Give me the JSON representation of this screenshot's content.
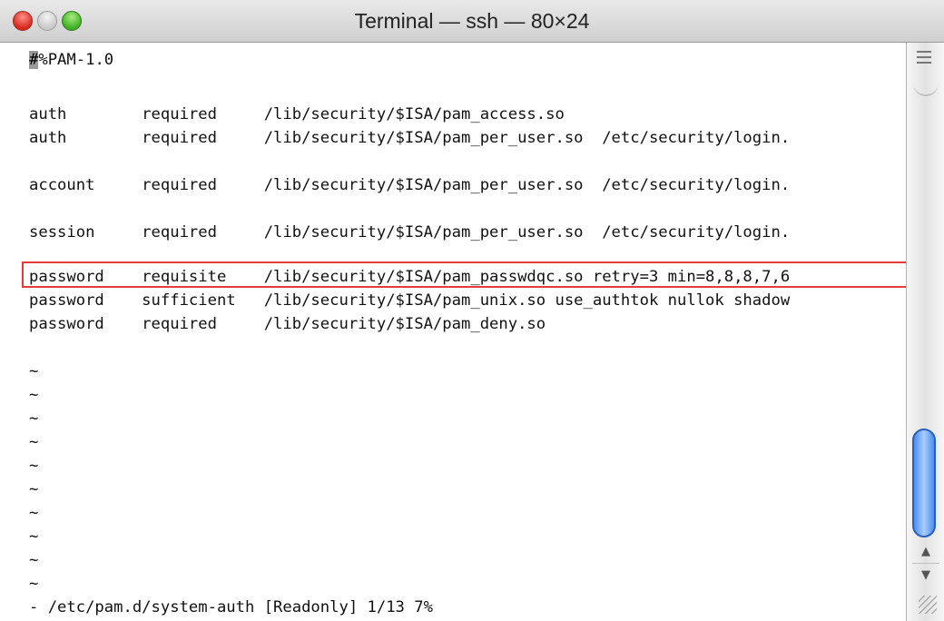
{
  "window": {
    "title": "Terminal — ssh — 80×24",
    "traffic_lights": [
      "close",
      "minimize",
      "zoom"
    ]
  },
  "terminal": {
    "lines": [
      "",
      "",
      "auth        required     /lib/security/$ISA/pam_access.so",
      "auth        required     /lib/security/$ISA/pam_per_user.so  /etc/security/login.",
      "",
      "account     required     /lib/security/$ISA/pam_per_user.so  /etc/security/login.",
      "",
      "session     required     /lib/security/$ISA/pam_per_user.so  /etc/security/login.",
      "",
      "password    requisite    /lib/security/$ISA/pam_passwdqc.so retry=3 min=8,8,8,7,6",
      "password    sufficient   /lib/security/$ISA/pam_unix.so use_authtok nullok shadow",
      "password    required     /lib/security/$ISA/pam_deny.so",
      "",
      "~",
      "~",
      "~",
      "~",
      "~",
      "~",
      "~",
      "~",
      "~",
      "~",
      "- /etc/pam.d/system-auth [Readonly] 1/13 7%"
    ],
    "first_line_cursor_char": "#",
    "first_line_rest": "%PAM-1.0",
    "highlighted_line_index": 9
  },
  "scrollbar": {
    "up_arrow": "▲",
    "down_arrow": "▼"
  },
  "icons": {
    "split": "split-pane-icon",
    "resize": "resize-grip-icon"
  },
  "colors": {
    "highlight_border": "#e33b3b",
    "scroll_thumb": "#4b8df2"
  }
}
